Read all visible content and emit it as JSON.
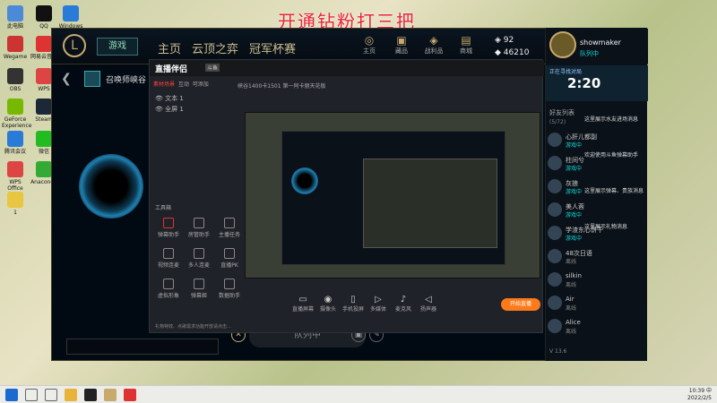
{
  "banner": "开通钻粉打三把",
  "desktop_icons": [
    {
      "label": "此电脑",
      "color": "#4a8ad8"
    },
    {
      "label": "QQ",
      "color": "#111"
    },
    {
      "label": "Windows 10",
      "color": "#2a7ad8"
    },
    {
      "label": "Wegame",
      "color": "#c33"
    },
    {
      "label": "网易云音乐",
      "color": "#d33"
    },
    {
      "label": "OBS",
      "color": "#333"
    },
    {
      "label": "WPS",
      "color": "#d44"
    },
    {
      "label": "GeForce Experience",
      "color": "#76b900"
    },
    {
      "label": "Steam",
      "color": "#1b2838"
    },
    {
      "label": "腾讯会议",
      "color": "#2a7ad8"
    },
    {
      "label": "微信",
      "color": "#2b2"
    },
    {
      "label": "WPS Office",
      "color": "#d44"
    },
    {
      "label": "Anaconda",
      "color": "#3a3"
    },
    {
      "label": "1",
      "color": "#e8c640"
    }
  ],
  "client": {
    "play_label": "游戏",
    "nav": [
      "主页",
      "云顶之弈",
      "冠军杯赛"
    ],
    "top_icons": [
      {
        "glyph": "◎",
        "label": "主页"
      },
      {
        "glyph": "▣",
        "label": "藏品"
      },
      {
        "glyph": "◈",
        "label": "战利品"
      },
      {
        "glyph": "▤",
        "label": "商城"
      }
    ],
    "currency": {
      "rp": "92",
      "be": "46210"
    },
    "mode_label": "召唤师峡谷",
    "queue_label": "队列中",
    "queue_cancel": "✕",
    "profile": {
      "name": "showmaker",
      "status": "队列中"
    },
    "queue_panel": {
      "label": "正在寻找对局",
      "time": "2:20"
    },
    "friends_header": "好友列表",
    "friends_count": "(5/72)",
    "friends": [
      {
        "name": "心肝儿都副",
        "status": "游戏中"
      },
      {
        "name": "柱间兮",
        "status": "游戏中"
      },
      {
        "name": "灰狼",
        "status": "游戏中"
      },
      {
        "name": "美人蓉",
        "status": "游戏中"
      },
      {
        "name": "学渣东心饼干",
        "status": "游戏中"
      },
      {
        "name": "48次日语",
        "status": "离线"
      },
      {
        "name": "silkin",
        "status": "离线"
      },
      {
        "name": "Air",
        "status": "离线"
      },
      {
        "name": "Alice",
        "status": "离线"
      }
    ],
    "chat": [
      "这里展示水友进场消息",
      "欢迎使用斗鱼弹幕助手",
      "这里展示弹幕、贵族消息",
      "这里展示礼物消息"
    ],
    "version": "V 13.6"
  },
  "tool": {
    "title": "直播伴侣",
    "badge": "斗鱼",
    "scene_tabs": [
      "素材场景",
      "互动",
      "可添加"
    ],
    "scenes": [
      "文本 1",
      "全屏 1"
    ],
    "toolbar_text": "峡谷1400卡1501 第一阿卡丽天花板",
    "tools_header": "工具箱",
    "tools": [
      {
        "label": "弹幕助手",
        "color": "#d33"
      },
      {
        "label": "房管助手",
        "color": "#888"
      },
      {
        "label": "主播任务",
        "color": "#888"
      },
      {
        "label": "视频连麦",
        "color": "#888"
      },
      {
        "label": "多人连麦",
        "color": "#888"
      },
      {
        "label": "直播PK",
        "color": "#888"
      },
      {
        "label": "虚拟形象",
        "color": "#888"
      },
      {
        "label": "弹幕姬",
        "color": "#888"
      },
      {
        "label": "数据助手",
        "color": "#888"
      }
    ],
    "bottom": [
      {
        "glyph": "▭",
        "label": "直播屏幕"
      },
      {
        "glyph": "◉",
        "label": "摄像头"
      },
      {
        "glyph": "▯",
        "label": "手机投屏"
      },
      {
        "glyph": "▷",
        "label": "多媒体"
      },
      {
        "glyph": "♪",
        "label": "麦克风"
      },
      {
        "glyph": "◁",
        "label": "扬声器"
      }
    ],
    "go_live": "开始直播",
    "notice": "礼物特效、点歌需求功能开放请点击..."
  },
  "taskbar": {
    "time": "10:39",
    "date": "2022/2/5",
    "ime": "中"
  }
}
